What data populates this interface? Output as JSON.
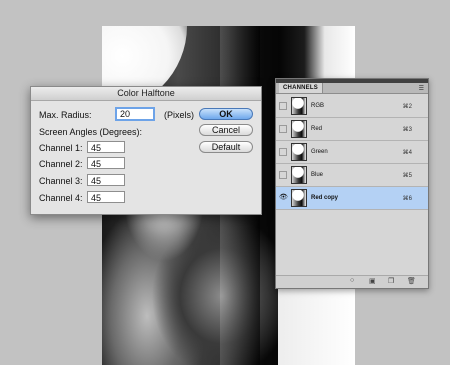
{
  "dialog": {
    "title": "Color Halftone",
    "max_radius_label": "Max. Radius:",
    "max_radius_value": "20",
    "max_radius_unit": "(Pixels)",
    "screen_angles_label": "Screen Angles (Degrees):",
    "channels": [
      {
        "label": "Channel 1:",
        "value": "45"
      },
      {
        "label": "Channel 2:",
        "value": "45"
      },
      {
        "label": "Channel 3:",
        "value": "45"
      },
      {
        "label": "Channel 4:",
        "value": "45"
      }
    ],
    "ok_label": "OK",
    "cancel_label": "Cancel",
    "default_label": "Default"
  },
  "channels_panel": {
    "tab_label": "CHANNELS",
    "menu_icon": "panel-menu-icon",
    "rows": [
      {
        "name": "RGB",
        "shortcut": "⌘2",
        "visible": false,
        "selected": false
      },
      {
        "name": "Red",
        "shortcut": "⌘3",
        "visible": false,
        "selected": false
      },
      {
        "name": "Green",
        "shortcut": "⌘4",
        "visible": false,
        "selected": false
      },
      {
        "name": "Blue",
        "shortcut": "⌘5",
        "visible": false,
        "selected": false
      },
      {
        "name": "Red copy",
        "shortcut": "⌘6",
        "visible": true,
        "selected": true
      }
    ],
    "footer_icons": [
      "load-selection-icon",
      "save-selection-icon",
      "new-channel-icon",
      "delete-channel-icon"
    ]
  },
  "colors": {
    "background": "#c2c2c2",
    "dialog_bg": "#e4e4e4",
    "ok_button": "#6fa8ec",
    "selected_row": "#b4d1f4",
    "focus_ring": "#6da3e8"
  }
}
